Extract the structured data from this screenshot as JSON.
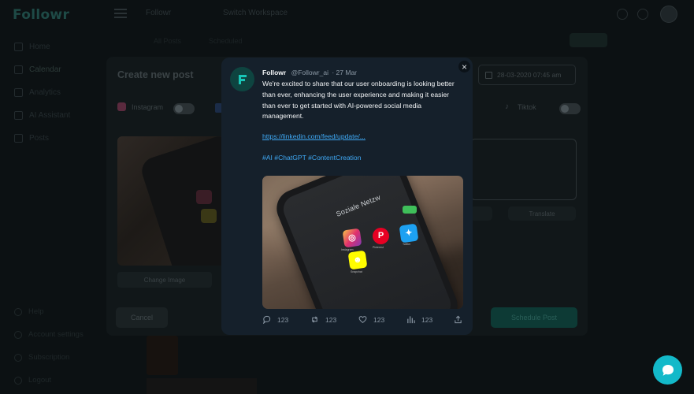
{
  "app": {
    "logo": "Followr",
    "top_items": [
      "Followr",
      "Switch Workspace"
    ],
    "sidebar": [
      "Home",
      "Calendar",
      "Analytics",
      "AI Assistant",
      "Posts"
    ],
    "sidebar_bottom": [
      "Help",
      "Account settings",
      "Subscription",
      "Logout"
    ],
    "subnav": [
      "All Posts",
      "Scheduled"
    ]
  },
  "create_post": {
    "title": "Create new post",
    "date": "28-03-2020 07:45 am",
    "platforms": [
      {
        "name": "Instagram",
        "icon": "instagram-icon"
      },
      {
        "name": "Tiktok",
        "icon": "tiktok-icon"
      }
    ],
    "change_image": "Change Image",
    "translate": "Translate",
    "cancel": "Cancel",
    "schedule": "Schedule Post"
  },
  "preview": {
    "name": "Followr",
    "handle": "@Followr_ai",
    "date": "· 27 Mar",
    "text": "We're excited to share that our user onboarding is looking better than ever, enhancing the user experience and making it easier than ever to get started with AI-powered social media management.",
    "link": "https://linkedin.com/feed/update/...",
    "hashtags": "#AI #ChatGPT #ContentCreation",
    "image_text": {
      "screen_title": "Soziale Netzw",
      "apps": [
        "Instagram",
        "Pinterest",
        "Twitter",
        "Snapchat"
      ]
    },
    "actions": {
      "reply": "123",
      "retweet": "123",
      "like": "123",
      "views": "123"
    }
  },
  "colors": {
    "card_bg": "#15202b",
    "link": "#3fa9f5",
    "accent": "#13b9c9",
    "brand": "#0e4440"
  }
}
